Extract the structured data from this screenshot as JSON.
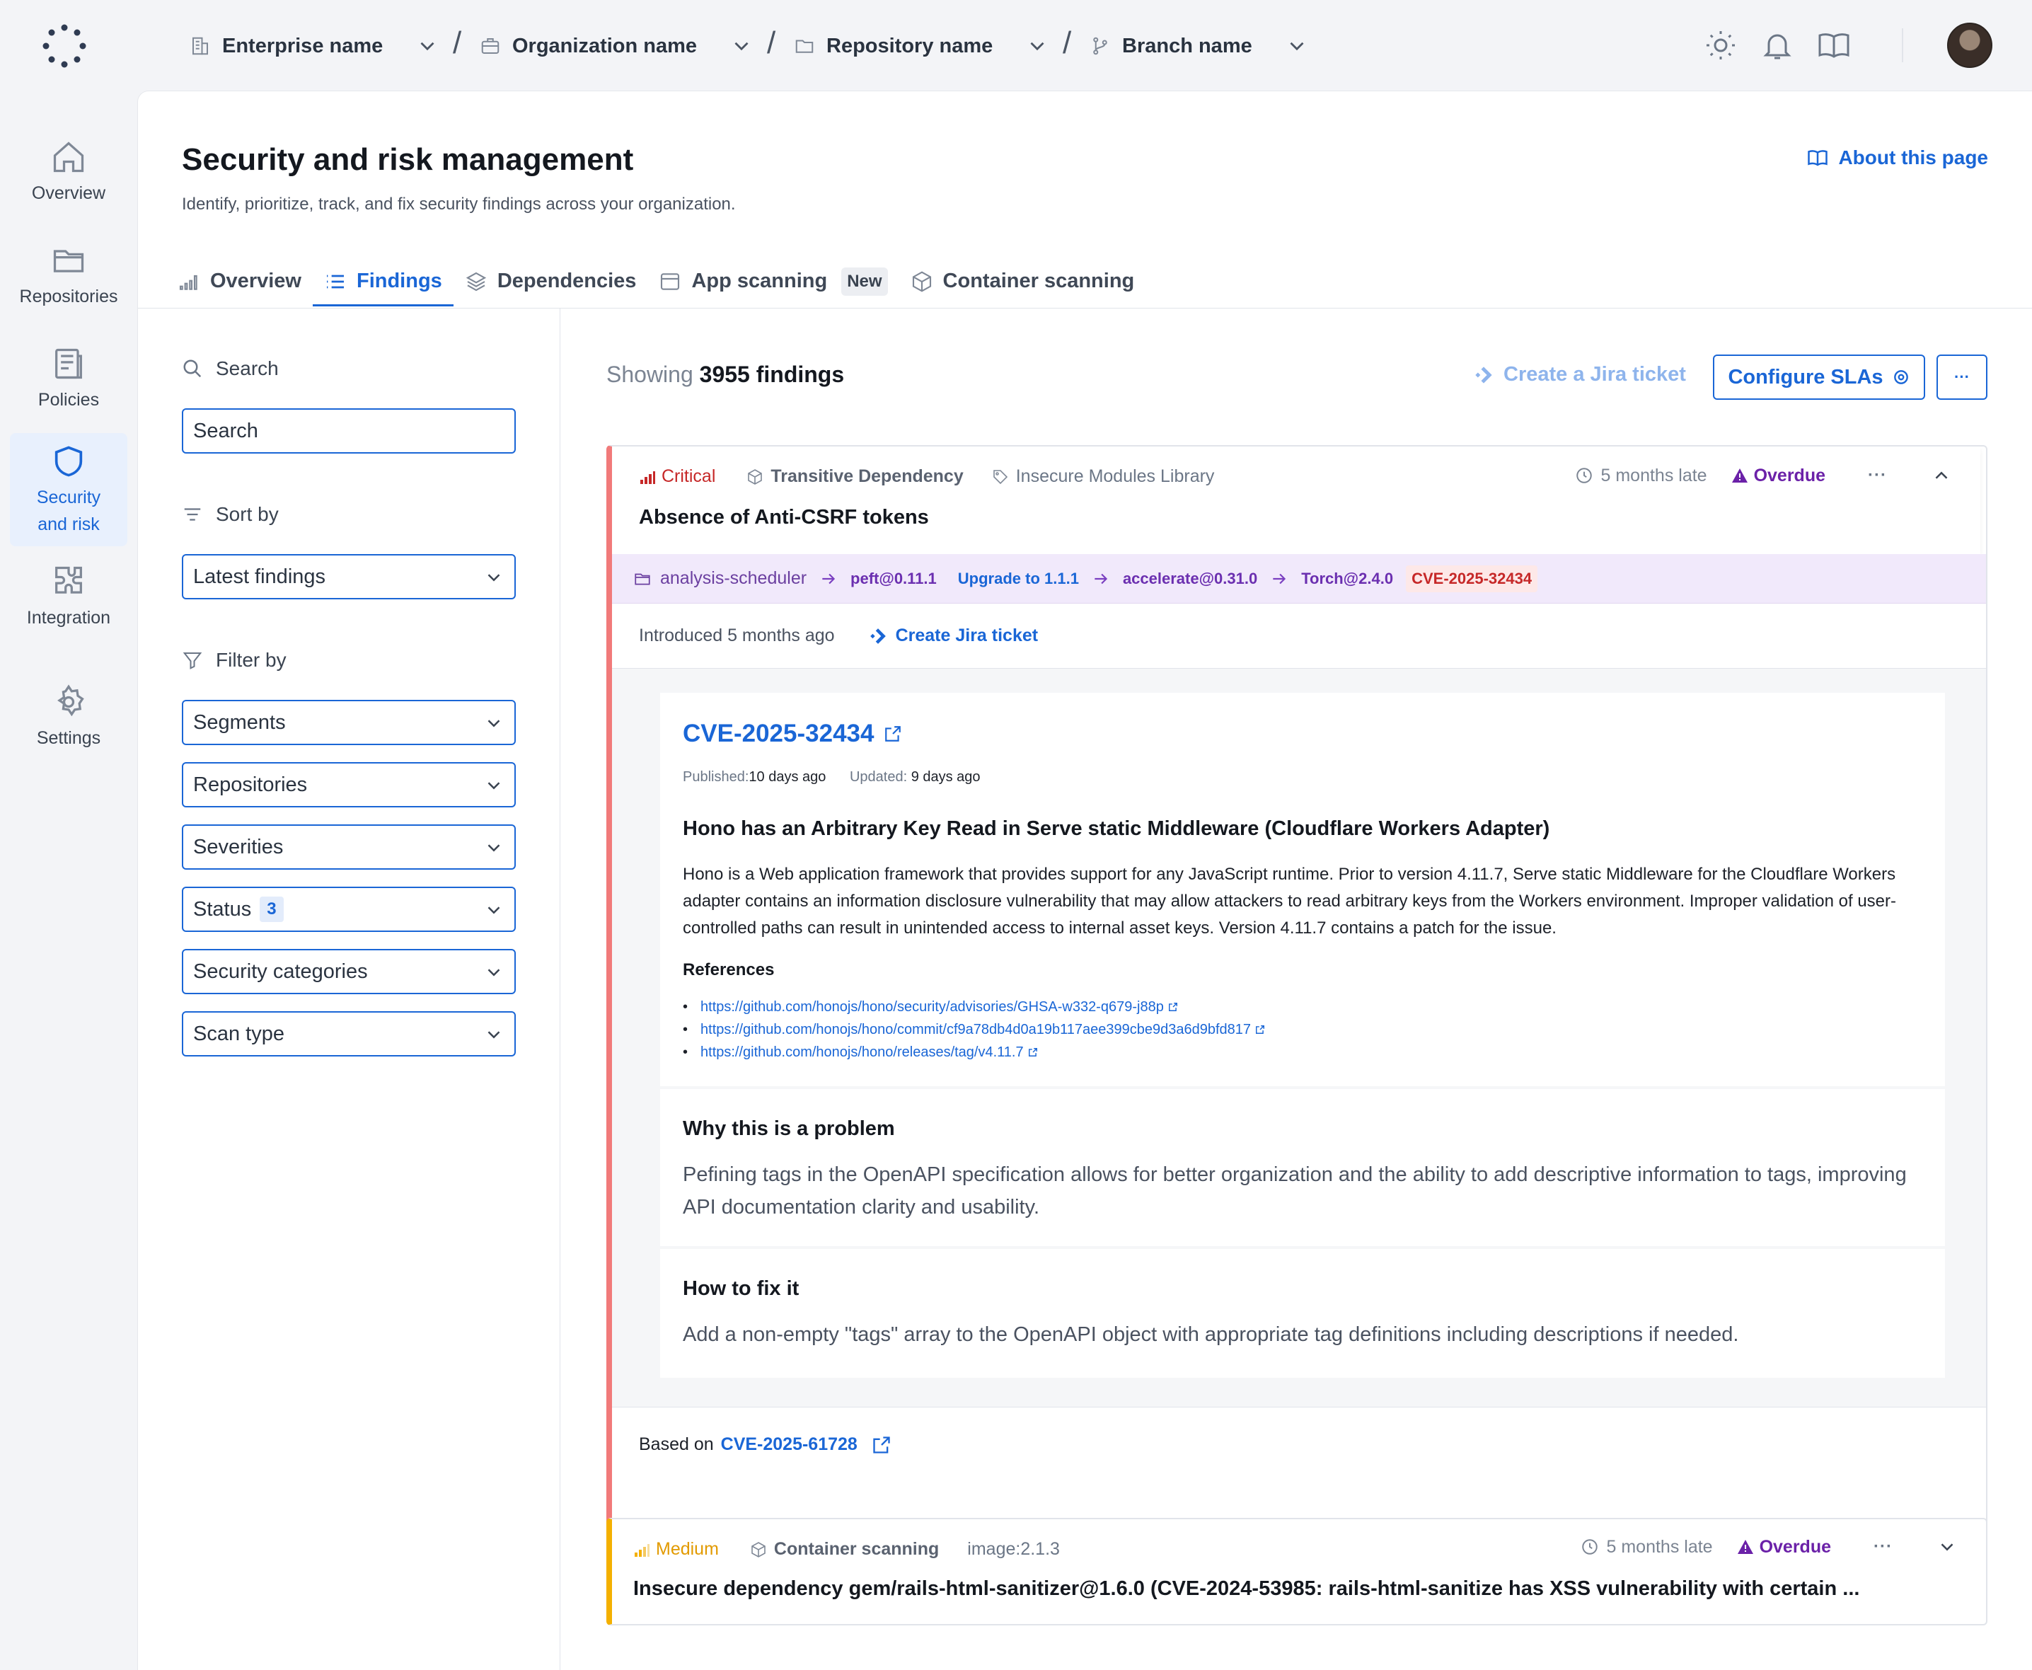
{
  "topbar": {
    "crumbs": [
      {
        "label": "Enterprise name",
        "icon": "building-icon"
      },
      {
        "label": "Organization name",
        "icon": "briefcase-icon"
      },
      {
        "label": "Repository name",
        "icon": "folder-icon"
      },
      {
        "label": "Branch name",
        "icon": "git-branch-icon"
      }
    ],
    "separator": "/",
    "icons": [
      "sun-icon",
      "bell-icon",
      "book-icon"
    ]
  },
  "sidebar": {
    "items": [
      {
        "label": "Overview",
        "icon": "home-icon"
      },
      {
        "label": "Repositories",
        "icon": "folder-icon"
      },
      {
        "label": "Policies",
        "icon": "document-icon"
      },
      {
        "label": "Security and risk",
        "icon": "shield-icon",
        "active": true
      },
      {
        "label": "Integration",
        "icon": "puzzle-icon"
      },
      {
        "label": "Settings",
        "icon": "gear-icon"
      }
    ]
  },
  "page": {
    "title": "Security and risk management",
    "subtitle": "Identify, prioritize, track, and fix security findings across your organization.",
    "about_label": "About this page"
  },
  "tabs": [
    {
      "label": "Overview",
      "icon": "bar-chart-icon"
    },
    {
      "label": "Findings",
      "icon": "list-icon",
      "active": true
    },
    {
      "label": "Dependencies",
      "icon": "layers-icon"
    },
    {
      "label": "App scanning",
      "icon": "window-icon",
      "badge": "New"
    },
    {
      "label": "Container scanning",
      "icon": "cube-icon"
    }
  ],
  "filters": {
    "search_label": "Search",
    "search_placeholder": "Search",
    "sort_label": "Sort by",
    "sort_value": "Latest findings",
    "filter_label": "Filter by",
    "dropdowns": [
      {
        "label": "Segments"
      },
      {
        "label": "Repositories"
      },
      {
        "label": "Severities"
      },
      {
        "label": "Status",
        "count": "3"
      },
      {
        "label": "Security categories"
      },
      {
        "label": "Scan type"
      }
    ]
  },
  "results": {
    "showing_prefix": "Showing",
    "showing_count": "3955 findings",
    "jira_label": "Create a Jira ticket",
    "configure_label": "Configure SLAs",
    "more_label": "···"
  },
  "finding1": {
    "severity": "Critical",
    "severity_color": "#c62828",
    "type": "Transitive Dependency",
    "library": "Insecure Modules Library",
    "late": "5 months late",
    "status": "Overdue",
    "more": "···",
    "title": "Absence of Anti-CSRF tokens",
    "path": {
      "repo": "analysis-scheduler",
      "pkg1": "peft@0.11.1",
      "upgrade": "Upgrade to 1.1.1",
      "pkg2": "accelerate@0.31.0",
      "pkg3": "Torch@2.4.0",
      "cve": "CVE-2025-32434"
    },
    "introduced": "Introduced 5 months ago",
    "create_jira": "Create Jira ticket",
    "cve": {
      "id": "CVE-2025-32434",
      "published_label": "Published:",
      "published_value": "10 days ago",
      "updated_label": "Updated:",
      "updated_value": "9 days ago",
      "title": "Hono has an Arbitrary Key Read in Serve static Middleware (Cloudflare Workers Adapter)",
      "description": "Hono is a Web application framework that provides support for any JavaScript runtime. Prior to version 4.11.7, Serve static Middleware for the Cloudflare Workers adapter contains an information disclosure vulnerability that may allow attackers to read arbitrary keys from the Workers environment. Improper validation of user-controlled paths can result in unintended access to internal asset keys. Version 4.11.7 contains a patch for the issue.",
      "references_label": "References",
      "references": [
        "https://github.com/honojs/hono/security/advisories/GHSA-w332-q679-j88p",
        "https://github.com/honojs/hono/commit/cf9a78db4d0a19b117aee399cbe9d3a6d9bfd817",
        "https://github.com/honojs/hono/releases/tag/v4.11.7"
      ]
    },
    "why_title": "Why this is a problem",
    "why_body": "Pefining tags in the OpenAPI specification allows for better organization and the ability to add descriptive information to tags, improving API documentation clarity and usability.",
    "fix_title": "How to fix it",
    "fix_body": "Add a non-empty \"tags\" array to the OpenAPI object with appropriate tag definitions including descriptions if needed.",
    "based_prefix": "Based on",
    "based_link": "CVE-2025-61728"
  },
  "finding2": {
    "severity": "Medium",
    "severity_color": "#f4b000",
    "type": "Container scanning",
    "image": "image:2.1.3",
    "late": "5 months late",
    "status": "Overdue",
    "more": "···",
    "title": "Insecure dependency gem/rails-html-sanitizer@1.6.0 (CVE-2024-53985: rails-html-sanitize has XSS vulnerability with certain ..."
  }
}
